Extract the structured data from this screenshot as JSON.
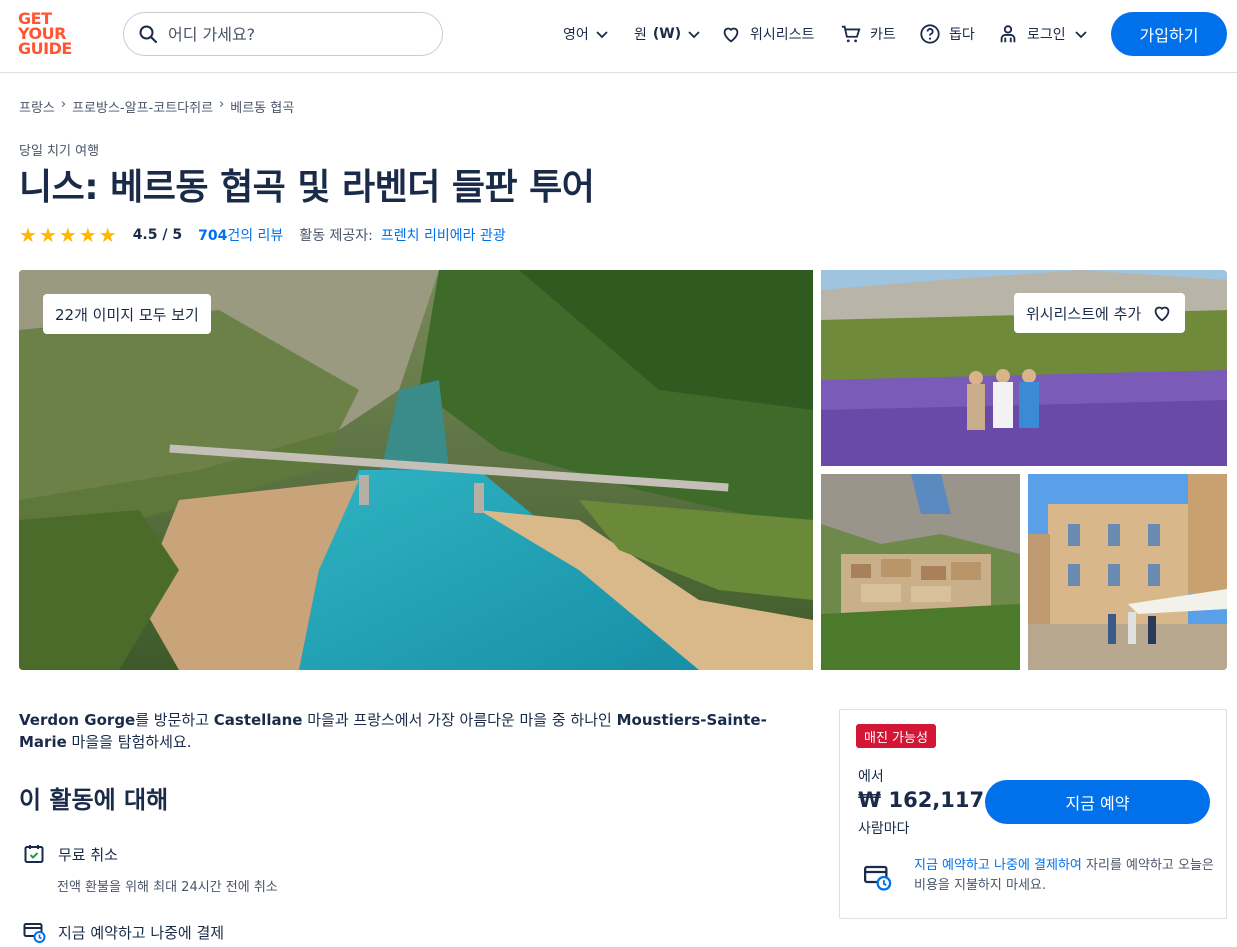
{
  "header": {
    "logo": [
      "GET",
      "YOUR",
      "GUIDE"
    ],
    "search_placeholder": "어디 가세요?",
    "language": "영어",
    "currency_prefix": "원",
    "currency_code": "(W)",
    "wishlist": "위시리스트",
    "cart": "카트",
    "help": "돕다",
    "login": "로그인",
    "signup": "가입하기"
  },
  "breadcrumb": [
    "프랑스",
    "프로방스-알프-코트다쥐르",
    "베르동 협곡"
  ],
  "category": "당일 치기 여행",
  "title": "니스: 베르동 협곡 및 라벤더 들판 투어",
  "rating": {
    "stars": 5,
    "value": "4.5 / 5",
    "review_count": "704",
    "review_suffix": "건의 리뷰",
    "provider_label": "활동 제공자:",
    "provider": "프렌치 리비에라 관광"
  },
  "gallery": {
    "all_images": "22개 이미지 모두 보기",
    "add_wishlist": "위시리스트에 추가"
  },
  "description": {
    "place1": "Verdon Gorge",
    "t1": "를 방문하고 ",
    "place2": "Castellane",
    "t2": " 마을과 프랑스에서 가장 아름다운 마을 중 하나인 ",
    "place3": "Moustiers-Sainte-Marie",
    "t3": " 마을을 탐험하세요."
  },
  "about": {
    "title": "이 활동에 대해",
    "free_cancel": "무료 취소",
    "free_cancel_sub": "전액 환불을 위해 최대 24시간 전에 취소",
    "reserve_later": "지금 예약하고 나중에 결제"
  },
  "booking": {
    "badge": "매진 가능성",
    "from": "에서",
    "price": "₩ 162,117",
    "per": "사람마다",
    "book": "지금 예약",
    "pay_later_link": "지금 예약하고 나중에 결제하여",
    "pay_later_text": " 자리를 예약하고 오늘은 비용을 지불하지 마세요."
  },
  "colors": {
    "brand": "#ff5533",
    "accent": "#0071eb",
    "badge": "#d31536",
    "star": "#ffb800"
  }
}
